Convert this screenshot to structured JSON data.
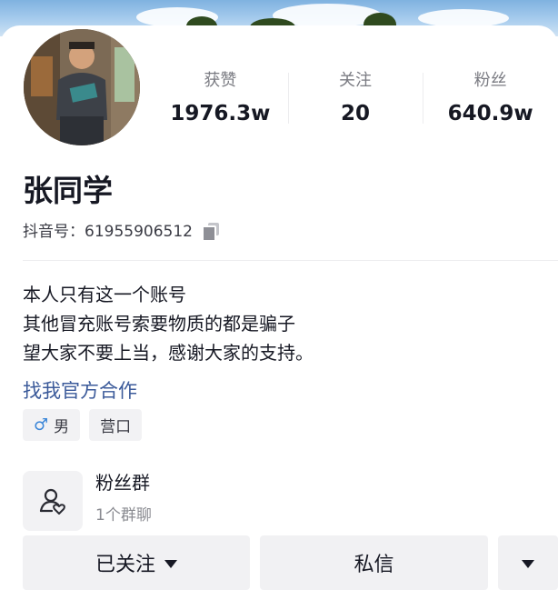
{
  "stats": [
    {
      "label": "获赞",
      "value": "1976.3w"
    },
    {
      "label": "关注",
      "value": "20"
    },
    {
      "label": "粉丝",
      "value": "640.9w"
    }
  ],
  "profile": {
    "name": "张同学",
    "douyin_id": "抖音号：61955906512"
  },
  "bio": {
    "lines": [
      "本人只有这一个账号",
      "其他冒充账号索要物质的都是骗子",
      "望大家不要上当，感谢大家的支持。"
    ],
    "link": "找我官方合作"
  },
  "tags": [
    {
      "icon": "male-icon",
      "text": "男"
    },
    {
      "text": "营口"
    }
  ],
  "fan_group": {
    "title": "粉丝群",
    "subtitle": "1个群聊"
  },
  "actions": {
    "following": "已关注",
    "message": "私信"
  },
  "colors": {
    "link": "#3b5a9a",
    "male": "#3a86d8",
    "button_bg": "#f1f1f3"
  }
}
